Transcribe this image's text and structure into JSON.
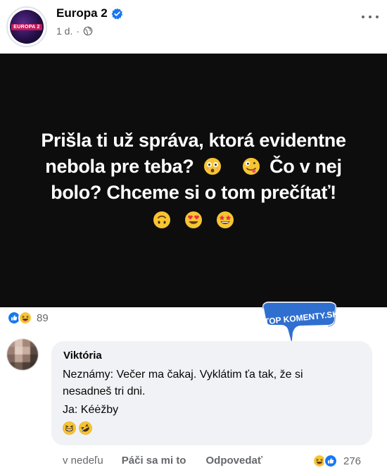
{
  "post": {
    "page_name": "Europa 2",
    "timestamp": "1 d.",
    "separator": "·",
    "avatar_logo": "EUROPA 2",
    "image_text": {
      "line1": "Prišla ti už správa, ktorá evidentne",
      "line2_a": "nebola pre teba?",
      "line2_b": "Čo v nej",
      "line3": "bolo? Chceme si o tom prečítať!"
    },
    "reaction_count": "89"
  },
  "watermark": {
    "text": "TOP KOMENTY.SK",
    "color": "#2a6fc9"
  },
  "comment": {
    "author": "Viktória",
    "line1": "Neznámy: Večer ma čakaj. Vyklátim ťa tak, že si",
    "line2": "nesadneš tri dni.",
    "line3": "Ja: Kéėžby",
    "time": "v nedeľu",
    "like_label": "Páči sa mi to",
    "reply_label": "Odpovedať",
    "reaction_count": "276"
  },
  "icons": {
    "verified": "verified-badge-icon",
    "globe": "globe-icon",
    "more": "more-options-icon",
    "like": "like-reaction-icon",
    "haha": "haha-reaction-icon"
  },
  "colors": {
    "accent": "#1877f2",
    "image_bg": "#0d0d0d",
    "bubble": "#f0f2f5",
    "muted": "#65676b"
  }
}
